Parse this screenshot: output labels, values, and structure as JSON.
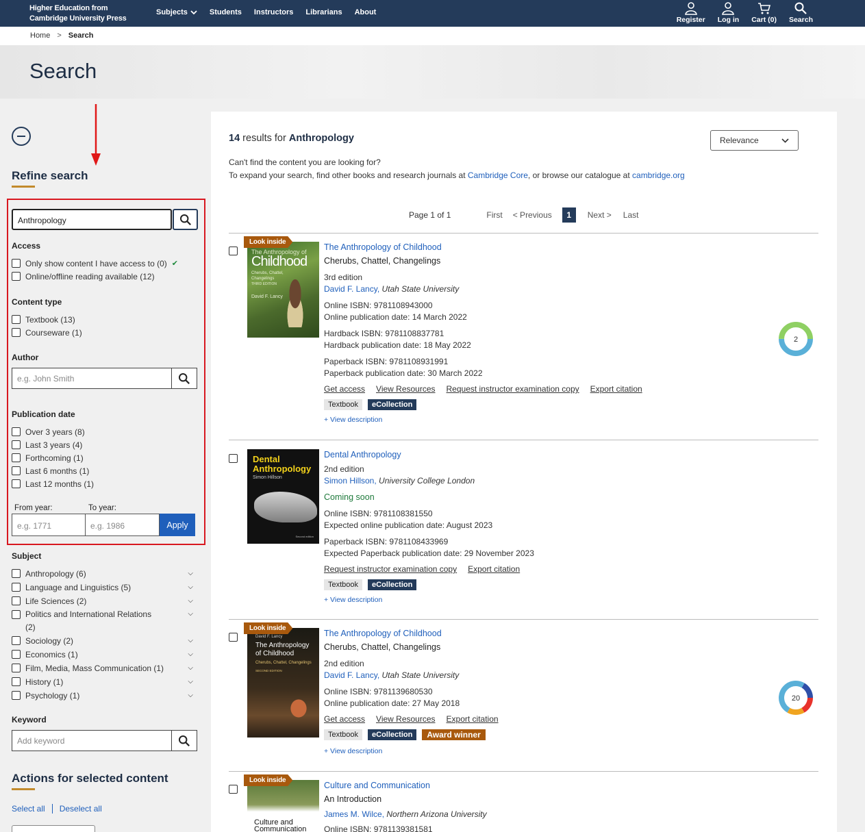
{
  "nav": {
    "brand_line1": "Higher Education from",
    "brand_line2": "Cambridge University Press",
    "links": [
      "Subjects",
      "Students",
      "Instructors",
      "Librarians",
      "About"
    ],
    "icons": [
      {
        "label": "Register",
        "icon": "person-add-icon"
      },
      {
        "label": "Log in",
        "icon": "person-icon"
      },
      {
        "label": "Cart (0)",
        "icon": "cart-icon"
      },
      {
        "label": "Search",
        "icon": "search-icon"
      }
    ]
  },
  "breadcrumb": {
    "home": "Home",
    "sep": ">",
    "current": "Search"
  },
  "page_title": "Search",
  "sidebar": {
    "refine_title": "Refine search",
    "search_value": "Anthropology",
    "access": {
      "title": "Access",
      "items": [
        "Only show content I have access to (0)",
        "Online/offline reading available (12)"
      ]
    },
    "content_type": {
      "title": "Content type",
      "items": [
        "Textbook (13)",
        "Courseware (1)"
      ]
    },
    "author": {
      "title": "Author",
      "placeholder": "e.g. John Smith"
    },
    "publication_date": {
      "title": "Publication date",
      "items": [
        "Over 3 years (8)",
        "Last 3 years (4)",
        "Forthcoming (1)",
        "Last 6 months (1)",
        "Last 12 months (1)"
      ],
      "from_label": "From year:",
      "to_label": "To year:",
      "from_placeholder": "e.g. 1771",
      "to_placeholder": "e.g. 1986",
      "apply": "Apply"
    },
    "subject": {
      "title": "Subject",
      "items": [
        {
          "label": "Anthropology (6)"
        },
        {
          "label": "Language and Linguistics (5)"
        },
        {
          "label": "Life Sciences (2)"
        },
        {
          "label": "Politics and International Relations",
          "count_line": "(2)"
        },
        {
          "label": "Sociology (2)"
        },
        {
          "label": "Economics (1)"
        },
        {
          "label": "Film, Media, Mass Communication (1)"
        },
        {
          "label": "History (1)"
        },
        {
          "label": "Psychology (1)"
        }
      ]
    },
    "keyword": {
      "title": "Keyword",
      "placeholder": "Add keyword"
    },
    "actions_title": "Actions for selected content",
    "select_all": "Select all",
    "deselect_all": "Deselect all"
  },
  "results": {
    "count": "14",
    "results_for": "results for",
    "query": "Anthropology",
    "sort": "Relevance",
    "notfound_line1": "Can't find the content you are looking for?",
    "notfound_line2_a": "To expand your search, find other books and research journals at ",
    "notfound_link1": "Cambridge Core",
    "notfound_line2_b": ", or browse our catalogue at ",
    "notfound_link2": "cambridge.org",
    "pager": {
      "page_of": "Page 1 of 1",
      "first": "First",
      "prev": "< Previous",
      "current": "1",
      "next": "Next >",
      "last": "Last"
    },
    "look_inside": "Look inside",
    "view_description": "+ View description",
    "items": [
      {
        "title": "The Anthropology of Childhood",
        "subtitle": "Cherubs, Chattel, Changelings",
        "edition": "3rd edition",
        "author": "David F. Lancy",
        "affiliation": "Utah State University",
        "isbn_blocks": [
          [
            "Online ISBN: 9781108943000",
            "Online publication date: 14 March 2022"
          ],
          [
            "Hardback ISBN: 9781108837781",
            "Hardback publication date: 18 May 2022"
          ],
          [
            "Paperback ISBN: 9781108931991",
            "Paperback publication date: 30 March 2022"
          ]
        ],
        "links": [
          "Get access",
          "View Resources",
          "Request instructor examination copy",
          "Export citation"
        ],
        "tags": [
          "Textbook",
          "eCollection"
        ],
        "altmetric": "2",
        "cover": {
          "title": "Childhood",
          "pre": "The Anthropology of",
          "sub": "Cherubs, Chattel, Changelings",
          "edition": "THIRD EDITION",
          "author": "David F. Lancy"
        }
      },
      {
        "title": "Dental Anthropology",
        "edition": "2nd edition",
        "author": "Simon Hillson",
        "affiliation": "University College London",
        "status": "Coming soon",
        "isbn_blocks": [
          [
            "Online ISBN: 9781108381550",
            "Expected online publication date: August 2023"
          ],
          [
            "Paperback ISBN: 9781108433969",
            "Expected Paperback publication date: 29 November 2023"
          ]
        ],
        "links": [
          "Request instructor examination copy",
          "Export citation"
        ],
        "tags": [
          "Textbook",
          "eCollection"
        ],
        "cover": {
          "title1": "Dental",
          "title2": "Anthropology",
          "author": "Simon Hillson",
          "edition": "Second edition"
        }
      },
      {
        "title": "The Anthropology of Childhood",
        "subtitle": "Cherubs, Chattel, Changelings",
        "edition": "2nd edition",
        "author": "David F. Lancy",
        "affiliation": "Utah State University",
        "isbn_blocks": [
          [
            "Online ISBN: 9781139680530",
            "Online publication date: 27 May 2018"
          ]
        ],
        "links": [
          "Get access",
          "View Resources",
          "Export citation"
        ],
        "tags": [
          "Textbook",
          "eCollection",
          "Award winner"
        ],
        "altmetric": "20",
        "cover": {
          "author": "David F. Lancy",
          "title1": "The Anthropology",
          "title2": "of Childhood",
          "sub": "Cherubs, Chattel, Changelings",
          "edition": "SECOND EDITION"
        }
      },
      {
        "title": "Culture and Communication",
        "subtitle": "An Introduction",
        "author": "James M. Wilce",
        "affiliation": "Northern Arizona University",
        "partial_line": "Online ISBN: 9781139381581",
        "cover": {
          "title1": "Culture and",
          "title2": "Communication"
        }
      }
    ]
  },
  "colors": {
    "navy": "#243b5a",
    "link": "#1f5fbb",
    "gold": "#a8590d",
    "highlight_red": "#d8171f"
  }
}
